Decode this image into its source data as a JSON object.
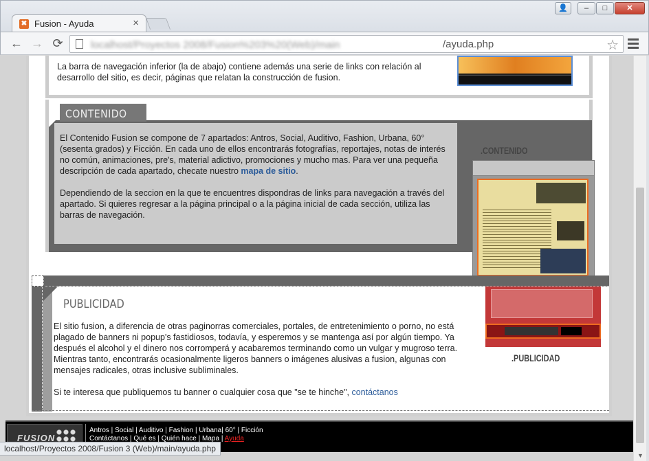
{
  "browser": {
    "tab_title": "Fusion - Ayuda",
    "tab_close": "×",
    "url_host": "localhost/Proyectos 2008/Fusion%203%20(Web)/main",
    "url_path": "/ayuda.php",
    "favicon": "✖",
    "status_url": "localhost/Proyectos 2008/Fusion 3 (Web)/main/ayuda.php",
    "window_buttons": {
      "min": "–",
      "max": "□",
      "close": "✕",
      "user": "👤"
    },
    "nav": {
      "back": "←",
      "forward": "→",
      "reload": "⟳",
      "star": "☆"
    }
  },
  "intro": {
    "text": "La barra de navegación inferior (la de abajo) contiene además una serie de links con relación al desarrollo del sitio, es decir, páginas que relatan la construcción de fusion."
  },
  "contenido": {
    "header": "CONTENIDO",
    "label": ".CONTENIDO",
    "p1_before": "El Contenido Fusion se compone de 7 apartados: Antros, Social, Auditivo, Fashion, Urbana, 60° (sesenta grados) y Ficción. En cada uno de ellos encontrarás fotografías, reportajes, notas de interés no común, animaciones, pre's, material adictivo, promociones y mucho mas. Para ver una pequeña descripción de cada apartado, checate nuestro ",
    "p1_link": "mapa de sitio",
    "p1_after": ".",
    "p2": "Dependiendo de la seccion en la que te encuentres dispondras de links para navegación a través del apartado. Si quieres regresar a la página principal o a la página inicial de cada sección, utiliza las barras de navegación."
  },
  "publicidad": {
    "header": "PUBLICIDAD",
    "label": ".PUBLICIDAD",
    "p1": "El sitio fusion, a diferencia de otras paginorras comerciales, portales, de entretenimiento o porno, no está plagado de banners ni popup's fastidiosos, todavía, y esperemos y se mantenga así por algún tiempo. Ya después el alcohol y el dinero nos corromperá y acabaremos terminando como un vulgar y mugroso terra. Mientras tanto, encontrarás ocasionalmente ligeros banners o imágenes alusivas a fusion, algunas con mensajes radicales, otras inclusive subliminales.",
    "p2_before": "Si te interesa que publiquemos tu banner o cualquier cosa que \"se te hinche\", ",
    "p2_link": "contáctanos"
  },
  "footer": {
    "logo": "FUSION",
    "row1": [
      "Antros",
      "Social",
      "Auditivo",
      "Fashion",
      "Urbana",
      "60°",
      "Ficción"
    ],
    "row2": [
      "Contáctanos",
      "Qué es",
      "Quién hace",
      "Mapa"
    ],
    "active": "Ayuda"
  }
}
